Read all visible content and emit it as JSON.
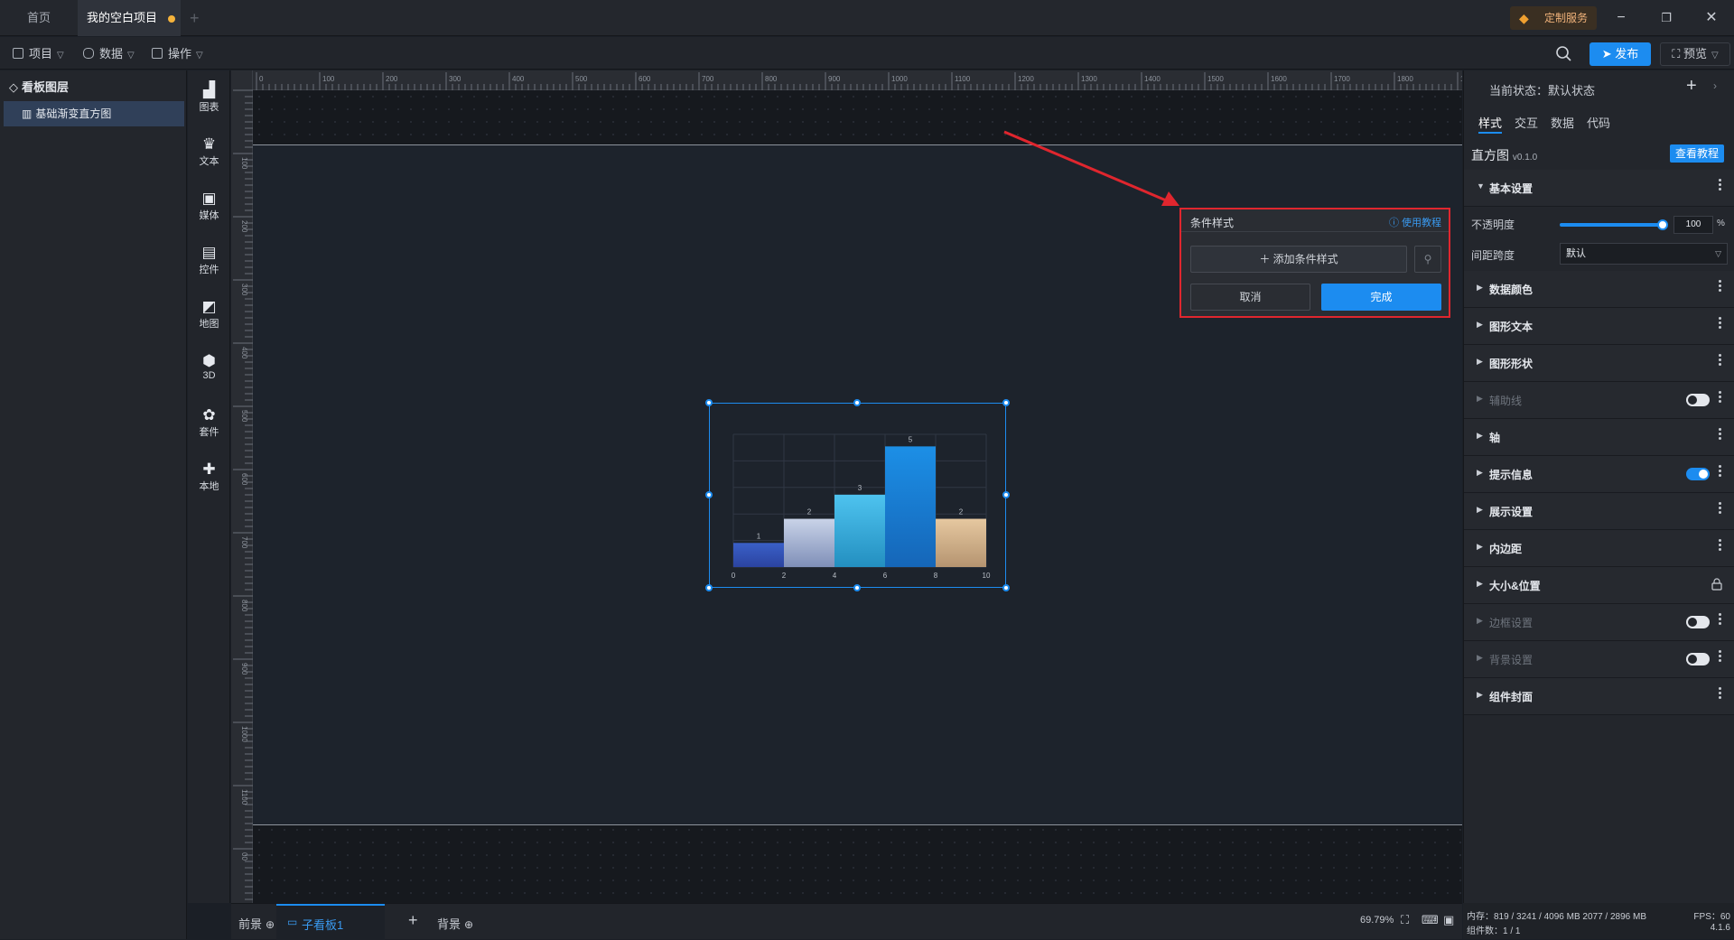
{
  "tabs": [
    {
      "label": "首页"
    },
    {
      "label": "我的空白项目"
    }
  ],
  "custom_service": "定制服务",
  "toolbar": {
    "project": "项目",
    "data": "数据",
    "operate": "操作",
    "publish": "发布",
    "preview": "预览"
  },
  "layers": {
    "title": "看板图层",
    "item": "基础渐变直方图"
  },
  "components": [
    "图表",
    "文本",
    "媒体",
    "控件",
    "地图",
    "3D",
    "套件",
    "本地"
  ],
  "ruler": {
    "top": [
      "0",
      "100",
      "200",
      "300",
      "400",
      "500",
      "600",
      "700",
      "800",
      "900",
      "1000",
      "1100",
      "1200",
      "1300",
      "1400",
      "1500",
      "1600",
      "1700",
      "1800",
      "1900"
    ],
    "left": [
      "100",
      "200",
      "300",
      "400",
      "500",
      "600",
      "700",
      "800",
      "900",
      "1000",
      "1100",
      "00"
    ]
  },
  "chart_data": {
    "type": "bar",
    "categories": [
      "0-2",
      "2-4",
      "4-6",
      "6-8",
      "8-10"
    ],
    "x_ticks": [
      "0",
      "2",
      "4",
      "6",
      "8",
      "10"
    ],
    "values": [
      1,
      2,
      3,
      5,
      2
    ],
    "ylim": [
      0,
      5.5
    ],
    "colors": [
      [
        "#3a5fc8",
        "#2b44a0"
      ],
      [
        "#c9d3e8",
        "#7f8fb8"
      ],
      [
        "#4ec3ef",
        "#238fc0"
      ],
      [
        "#1c8fe6",
        "#1566b8"
      ],
      [
        "#e6c8a0",
        "#b59470"
      ]
    ],
    "grid": true
  },
  "condition_popup": {
    "title": "条件样式",
    "help": "使用教程",
    "add": "添加条件样式",
    "cancel": "取消",
    "done": "完成"
  },
  "bottom": {
    "front": "前景",
    "board": "子看板1",
    "background": "背景",
    "zoom": "69.79%"
  },
  "right_panel": {
    "state_label": "当前状态：默认状态",
    "tabs": [
      "样式",
      "交互",
      "数据",
      "代码"
    ],
    "component_name": "直方图",
    "version": "v0.1.0",
    "tutorial": "查看教程",
    "basic_settings": "基本设置",
    "opacity_label": "不透明度",
    "opacity_value": "100",
    "opacity_unit": "%",
    "spacing_label": "间距跨度",
    "spacing_value": "默认",
    "sections": [
      {
        "label": "数据颜色",
        "dim": false,
        "ctrl": "dots"
      },
      {
        "label": "图形文本",
        "dim": false,
        "ctrl": "dots"
      },
      {
        "label": "图形形状",
        "dim": false,
        "ctrl": "dots"
      },
      {
        "label": "辅助线",
        "dim": true,
        "ctrl": "toggle-off"
      },
      {
        "label": "轴",
        "dim": false,
        "ctrl": "dots"
      },
      {
        "label": "提示信息",
        "dim": false,
        "ctrl": "toggle-on"
      },
      {
        "label": "展示设置",
        "dim": false,
        "ctrl": "dots"
      },
      {
        "label": "内边距",
        "dim": false,
        "ctrl": "dots"
      },
      {
        "label": "大小&位置",
        "dim": false,
        "ctrl": "lock"
      },
      {
        "label": "边框设置",
        "dim": true,
        "ctrl": "toggle-off"
      },
      {
        "label": "背景设置",
        "dim": true,
        "ctrl": "toggle-off"
      },
      {
        "label": "组件封面",
        "dim": false,
        "ctrl": "dots"
      }
    ]
  },
  "status": {
    "memory": "内存：819 / 3241 / 4096 MB 2077 / 2896 MB",
    "fps": "FPS：60",
    "count": "组件数：1 / 1",
    "version": "4.1.6"
  }
}
